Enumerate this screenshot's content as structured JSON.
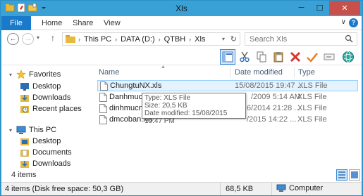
{
  "window": {
    "title": "Xls",
    "minimize_glyph": "─",
    "maximize_glyph": "☐",
    "close_glyph": "✕"
  },
  "ribbon": {
    "tabs": [
      "File",
      "Home",
      "Share",
      "View"
    ],
    "expand_glyph": "∨",
    "help_glyph": "?"
  },
  "address": {
    "breadcrumbs": [
      "This PC",
      "DATA (D:)",
      "QTBH",
      "Xls"
    ],
    "separator": "›",
    "back_glyph": "←",
    "forward_glyph": "→",
    "up_glyph": "↑",
    "dropdown_glyph": "▾",
    "refresh_glyph": "↻"
  },
  "search": {
    "placeholder": "Search Xls"
  },
  "toolbar": {
    "icons": [
      "details-pane-icon",
      "cut-icon",
      "copy-icon",
      "paste-icon",
      "delete-icon",
      "checkmark-icon",
      "rename-icon",
      "globe-icon"
    ]
  },
  "navigation": {
    "favorites": {
      "label": "Favorites",
      "items": [
        "Desktop",
        "Downloads",
        "Recent places"
      ]
    },
    "this_pc": {
      "label": "This PC",
      "items": [
        "Desktop",
        "Documents",
        "Downloads"
      ]
    }
  },
  "columns": {
    "name": "Name",
    "date": "Date modified",
    "type": "Type"
  },
  "files": [
    {
      "name": "ChungtuNX.xls",
      "date": "15/08/2015 19:47 ...",
      "type": "XLS File",
      "selected": true
    },
    {
      "name": "DanhmucN",
      "date": "/2009 5:14 AM",
      "type": "XLS File",
      "selected": false
    },
    {
      "name": "dinhmucn",
      "date": "6/2014 21:28 ...",
      "type": "XLS File",
      "selected": false
    },
    {
      "name": "dmcoban.xls",
      "date": "/2015 14:22 ...",
      "type": "XLS File",
      "selected": false
    }
  ],
  "tooltip": {
    "type_line": "Type: XLS File",
    "size_line": "Size: 20,5 KB",
    "date_line": "Date modified: 15/08/2015 19:47 PM"
  },
  "status": {
    "item_count": "4 items",
    "summary": "4 items (Disk free space: 50,3 GB)",
    "size": "68,5 KB",
    "location": "Computer"
  },
  "colors": {
    "title_bar": "#3aa1d6",
    "file_tab": "#1979ca",
    "close_button": "#c7504a",
    "selection": "#e5f3ff"
  }
}
